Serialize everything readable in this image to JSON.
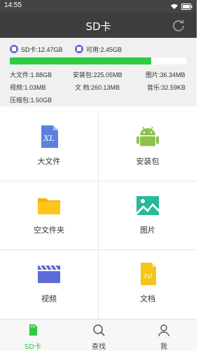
{
  "status_bar": {
    "time": "14:55"
  },
  "header": {
    "title": "SD卡"
  },
  "storage": {
    "total_label": "SD卡:12.47GB",
    "available_label": "可用:2.45GB",
    "used_fraction": 0.8,
    "stats": {
      "large_files": "大文件:1.88GB",
      "packages": "安装包:225.05MB",
      "images": "图片:36.34MB",
      "videos": "视频:1.03MB",
      "documents": "文 档:260.13MB",
      "music": "音乐:32.59KB",
      "archives": "压缩包:1.50GB"
    }
  },
  "categories": [
    {
      "label": "大文件",
      "icon": "large-file-icon"
    },
    {
      "label": "安装包",
      "icon": "android-icon"
    },
    {
      "label": "空文件夹",
      "icon": "folder-icon"
    },
    {
      "label": "图片",
      "icon": "image-icon"
    },
    {
      "label": "视频",
      "icon": "video-icon"
    },
    {
      "label": "文档",
      "icon": "document-icon"
    }
  ],
  "tabs": [
    {
      "label": "SD卡",
      "icon": "sd-card-icon",
      "active": true
    },
    {
      "label": "查找",
      "icon": "search-icon",
      "active": false
    },
    {
      "label": "我",
      "icon": "person-icon",
      "active": false
    }
  ],
  "colors": {
    "accent": "#2ecc40",
    "header": "#3d3d3d",
    "status_bar": "#444444"
  }
}
